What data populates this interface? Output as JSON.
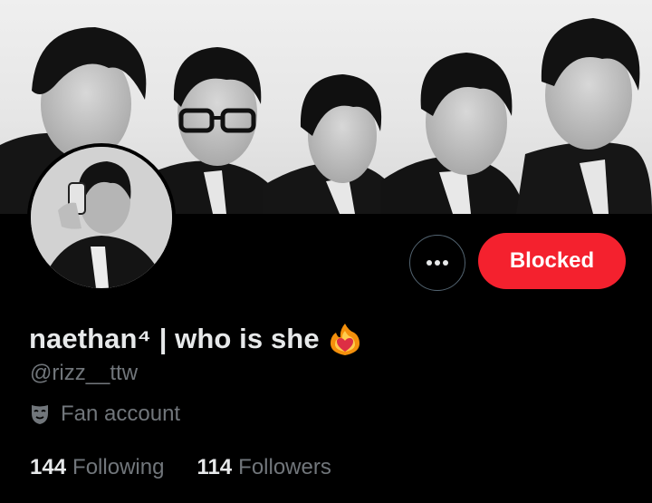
{
  "profile": {
    "display_name": "naethan⁴ | who is she",
    "handle": "@rizz__ttw",
    "account_type_label": "Fan account",
    "name_emoji": "fire-heart-icon",
    "account_type_icon": "performing-arts-mask-icon"
  },
  "actions": {
    "more_icon": "more-horizontal-icon",
    "blocked_label": "Blocked"
  },
  "stats": {
    "following_count": "144",
    "following_label": "Following",
    "followers_count": "114",
    "followers_label": "Followers"
  },
  "colors": {
    "background": "#000000",
    "primary_text": "#e7e9ea",
    "secondary_text": "#71767b",
    "blocked_button": "#f4212e",
    "more_button_border": "#536471"
  }
}
